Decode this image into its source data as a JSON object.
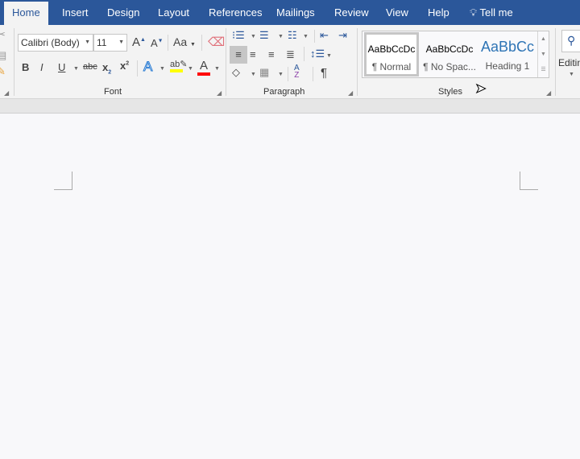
{
  "tabs": [
    "Home",
    "Insert",
    "Design",
    "Layout",
    "References",
    "Mailings",
    "Review",
    "View",
    "Help",
    "Tell me"
  ],
  "font": {
    "name": "Calibri (Body)",
    "size": "11",
    "group_label": "Font",
    "change_case": "Aa"
  },
  "paragraph": {
    "group_label": "Paragraph"
  },
  "styles": {
    "group_label": "Styles",
    "items": [
      {
        "sample": "AaBbCcDc",
        "name": "¶ Normal"
      },
      {
        "sample": "AaBbCcDc",
        "name": "¶ No Spac..."
      },
      {
        "sample": "AaBbCc",
        "name": "Heading 1"
      }
    ]
  },
  "editing": {
    "label": "Editing"
  },
  "colors": {
    "accent": "#2b579a",
    "highlight": "#ffff00",
    "font_color": "#ff0000"
  }
}
